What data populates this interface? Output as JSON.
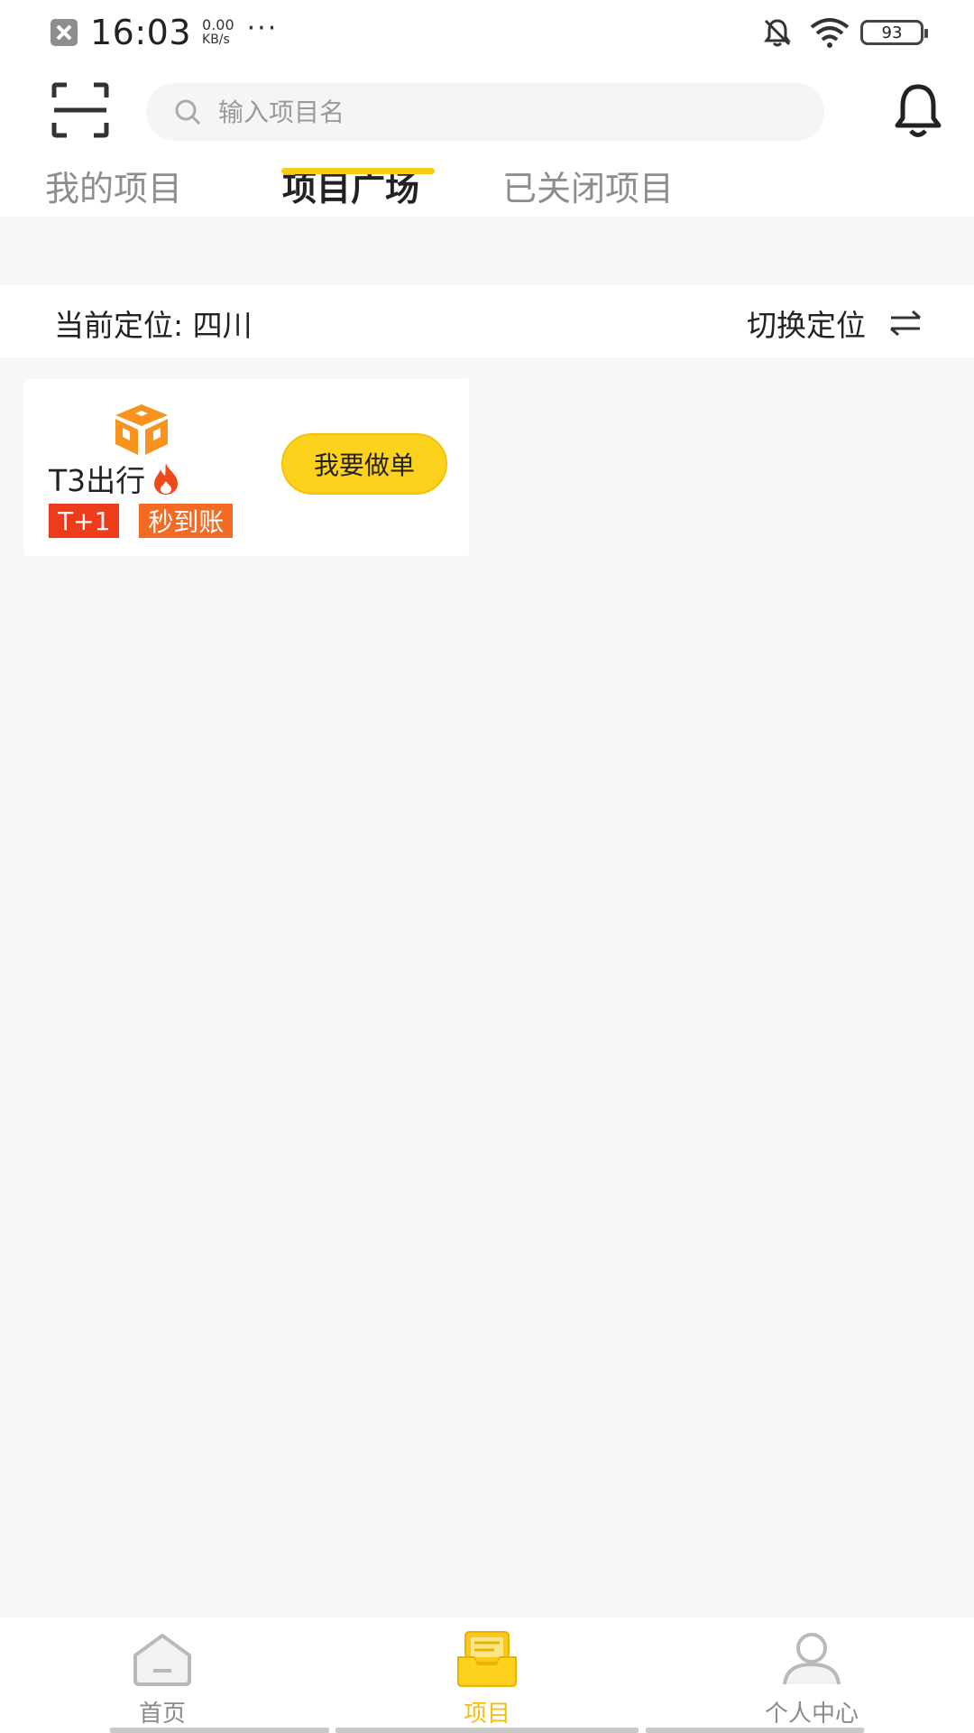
{
  "status_bar": {
    "time": "16:03",
    "net_speed_value": "0.00",
    "net_speed_unit": "KB/s",
    "more": "···",
    "battery": "93"
  },
  "header": {
    "search_placeholder": "输入项目名",
    "tabs": [
      {
        "label": "我的项目",
        "active": false
      },
      {
        "label": "项目广场",
        "active": true
      },
      {
        "label": "已关闭项目",
        "active": false
      }
    ],
    "accent_color": "#f6cf14"
  },
  "location": {
    "label": "当前定位: 四川",
    "switch_label": "切换定位"
  },
  "projects": [
    {
      "name": "T3出行",
      "hot": true,
      "badges": [
        "T+1",
        "秒到账"
      ],
      "action_label": "我要做单"
    }
  ],
  "bottom_nav": {
    "items": [
      {
        "label": "首页",
        "icon": "home-icon",
        "active": false
      },
      {
        "label": "项目",
        "icon": "project-icon",
        "active": true
      },
      {
        "label": "个人中心",
        "icon": "profile-icon",
        "active": false
      }
    ]
  }
}
